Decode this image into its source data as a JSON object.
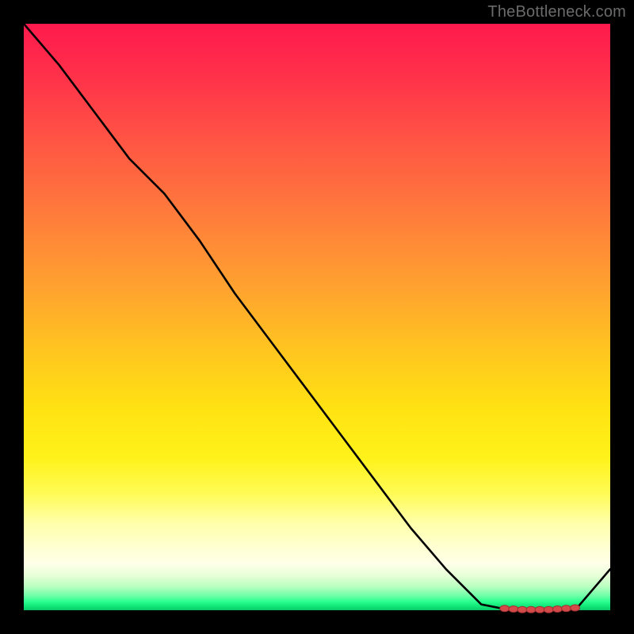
{
  "watermark": "TheBottleneck.com",
  "chart_data": {
    "type": "line",
    "title": "",
    "xlabel": "",
    "ylabel": "",
    "x": [
      0.0,
      0.06,
      0.12,
      0.18,
      0.24,
      0.3,
      0.36,
      0.42,
      0.48,
      0.54,
      0.6,
      0.66,
      0.72,
      0.78,
      0.83,
      0.86,
      0.9,
      0.94,
      1.0
    ],
    "values": [
      1.0,
      0.93,
      0.85,
      0.77,
      0.71,
      0.63,
      0.54,
      0.46,
      0.38,
      0.3,
      0.22,
      0.14,
      0.07,
      0.01,
      0.0,
      0.0,
      0.0,
      0.0,
      0.07
    ],
    "xlim": [
      0,
      1
    ],
    "ylim": [
      0,
      1
    ],
    "marker_cluster": {
      "xs": [
        0.82,
        0.835,
        0.85,
        0.865,
        0.88,
        0.895,
        0.91,
        0.925,
        0.94
      ],
      "ys": [
        0.003,
        0.002,
        0.001,
        0.001,
        0.001,
        0.001,
        0.002,
        0.003,
        0.004
      ]
    },
    "gradient_stops": [
      {
        "pos": 0.0,
        "color": "#ff1a4d"
      },
      {
        "pos": 0.45,
        "color": "#ffa22f"
      },
      {
        "pos": 0.74,
        "color": "#fff21a"
      },
      {
        "pos": 0.92,
        "color": "#ffffe8"
      },
      {
        "pos": 1.0,
        "color": "#0cc868"
      }
    ]
  }
}
